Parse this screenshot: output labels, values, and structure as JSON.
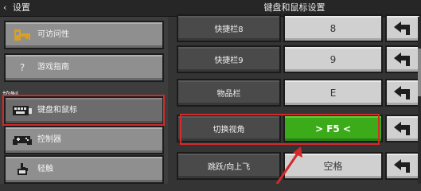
{
  "header": {
    "back_label": "设置",
    "title": "键盘和鼠标设置"
  },
  "sidebar": {
    "items": [
      {
        "label": "可访问性",
        "icon": "key-icon"
      },
      {
        "label": "游戏指南",
        "icon": "question-icon"
      },
      {
        "label": "键盘和鼠标",
        "icon": "keyboard-icon",
        "selected": true
      },
      {
        "label": "控制器",
        "icon": "gamepad-icon"
      },
      {
        "label": "轻触",
        "icon": "touch-hand-icon"
      }
    ],
    "section_label": "控制"
  },
  "bindings": [
    {
      "action": "快捷栏8",
      "key": "8"
    },
    {
      "action": "快捷栏9",
      "key": "9"
    },
    {
      "action": "物品栏",
      "key": "E"
    },
    {
      "action": "切换视角",
      "key": "> F5 <",
      "active": true
    },
    {
      "action": "跳跃/向上飞",
      "key": "空格"
    }
  ],
  "colors": {
    "highlight": "#d22a2a",
    "active_key": "#3cab1a"
  }
}
